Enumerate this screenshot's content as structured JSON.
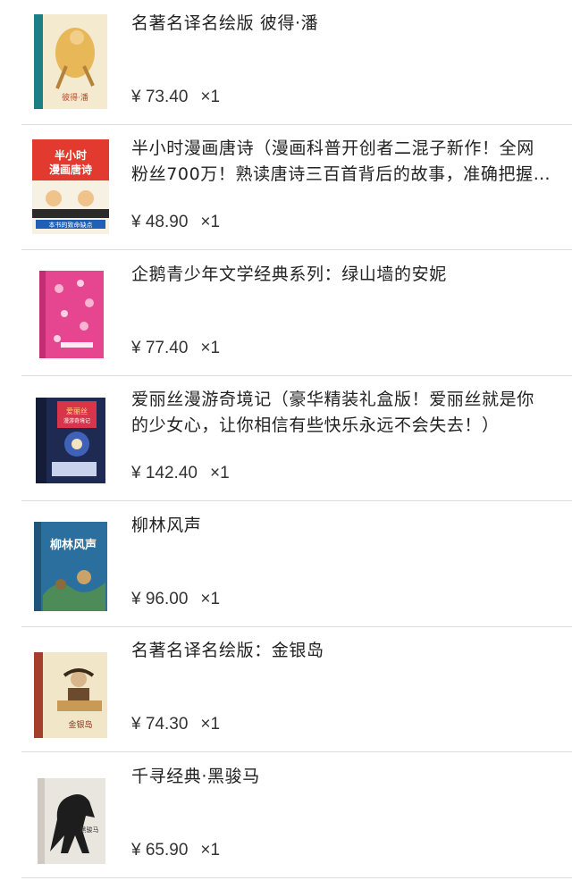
{
  "items": [
    {
      "title": "名著名译名绘版 彼得·潘",
      "price": "¥ 73.40",
      "qty": "×1",
      "cover": "book-cover-peter-pan",
      "cover_color": "#1b7f86",
      "cover_text": "彼得·潘"
    },
    {
      "title": "半小时漫画唐诗（漫画科普开创者二混子新作！全网粉丝700万！熟读唐诗三百首背后的故事，准确把握唐诗精髓）",
      "price": "¥ 48.90",
      "qty": "×1",
      "cover": "book-cover-tang-poetry",
      "cover_color": "#e23a2f",
      "cover_text": "半小时漫画唐诗"
    },
    {
      "title": "企鹅青少年文学经典系列：绿山墙的安妮",
      "price": "¥ 77.40",
      "qty": "×1",
      "cover": "book-cover-anne",
      "cover_color": "#e6458f",
      "cover_text": ""
    },
    {
      "title": "爱丽丝漫游奇境记（豪华精装礼盒版！爱丽丝就是你的少女心，让你相信有些快乐永远不会失去！）",
      "price": "¥ 142.40",
      "qty": "×1",
      "cover": "book-cover-alice",
      "cover_color": "#1f2a52",
      "cover_text": "爱丽丝"
    },
    {
      "title": "柳林风声",
      "price": "¥ 96.00",
      "qty": "×1",
      "cover": "book-cover-wind-willows",
      "cover_color": "#2a6f9e",
      "cover_text": "柳林风声"
    },
    {
      "title": "名著名译名绘版：金银岛",
      "price": "¥ 74.30",
      "qty": "×1",
      "cover": "book-cover-treasure-island",
      "cover_color": "#a33f2a",
      "cover_text": "金银岛"
    },
    {
      "title": "千寻经典·黑骏马",
      "price": "¥ 65.90",
      "qty": "×1",
      "cover": "book-cover-black-beauty",
      "cover_color": "#e9e6df",
      "cover_text": "黑骏马"
    }
  ]
}
